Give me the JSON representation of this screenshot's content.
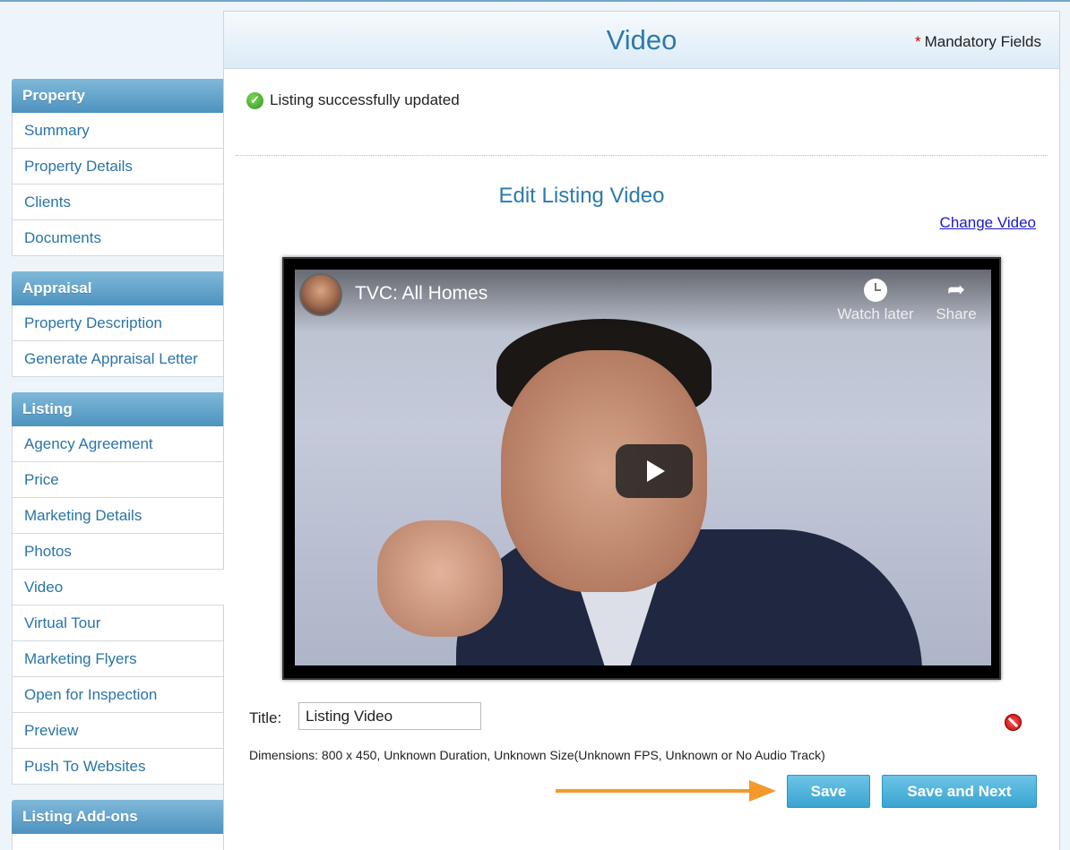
{
  "sidebar": {
    "sections": [
      {
        "header": "Property",
        "items": [
          "Summary",
          "Property Details",
          "Clients",
          "Documents"
        ]
      },
      {
        "header": "Appraisal",
        "items": [
          "Property Description",
          "Generate Appraisal Letter"
        ]
      },
      {
        "header": "Listing",
        "items": [
          "Agency Agreement",
          "Price",
          "Marketing Details",
          "Photos",
          "Video",
          "Virtual Tour",
          "Marketing Flyers",
          "Open for Inspection",
          "Preview",
          "Push To Websites"
        ]
      },
      {
        "header": "Listing Add-ons",
        "items": []
      }
    ],
    "active_item": "Video"
  },
  "header": {
    "title": "Video",
    "mandatory_star": "*",
    "mandatory_label": "Mandatory Fields"
  },
  "status": {
    "message": "Listing successfully updated"
  },
  "edit": {
    "heading": "Edit Listing Video",
    "change_video_link": "Change Video"
  },
  "video": {
    "title": "TVC: All Homes",
    "watch_later_label": "Watch later",
    "share_label": "Share"
  },
  "form": {
    "title_label": "Title:",
    "title_value": "Listing Video",
    "dimensions_text": "Dimensions: 800 x 450, Unknown Duration, Unknown Size(Unknown FPS, Unknown or No Audio Track)"
  },
  "buttons": {
    "save_label": "Save",
    "save_next_label": "Save and Next"
  },
  "colors": {
    "accent": "#2d7aab",
    "button": "#3aa4d0",
    "arrow": "#f39a2a"
  }
}
